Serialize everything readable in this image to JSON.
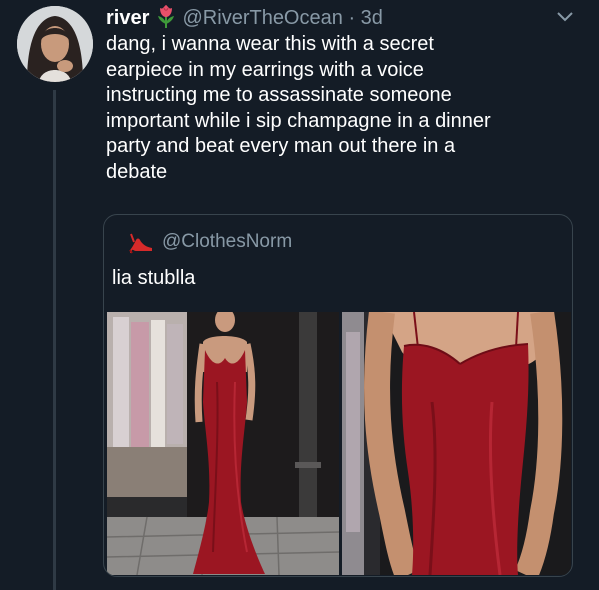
{
  "tweet": {
    "name": "river",
    "name_emoji_icon": "rose-icon",
    "handle": "@RiverTheOcean",
    "separator": "·",
    "time": "3d",
    "text_lines": [
      "dang, i wanna wear this with a secret",
      "earpiece in my earrings with a voice",
      "instructing me to assassinate someone",
      "important while i sip champagne in a dinner",
      "party and beat every man out there in a",
      "debate"
    ]
  },
  "quote": {
    "icon": "high-heel-icon",
    "handle": "@ClothesNorm",
    "text": "lia stublla"
  },
  "colors": {
    "background": "#141c26",
    "muted": "#8899a6",
    "border": "#38444d",
    "dress": "#9b1622"
  }
}
